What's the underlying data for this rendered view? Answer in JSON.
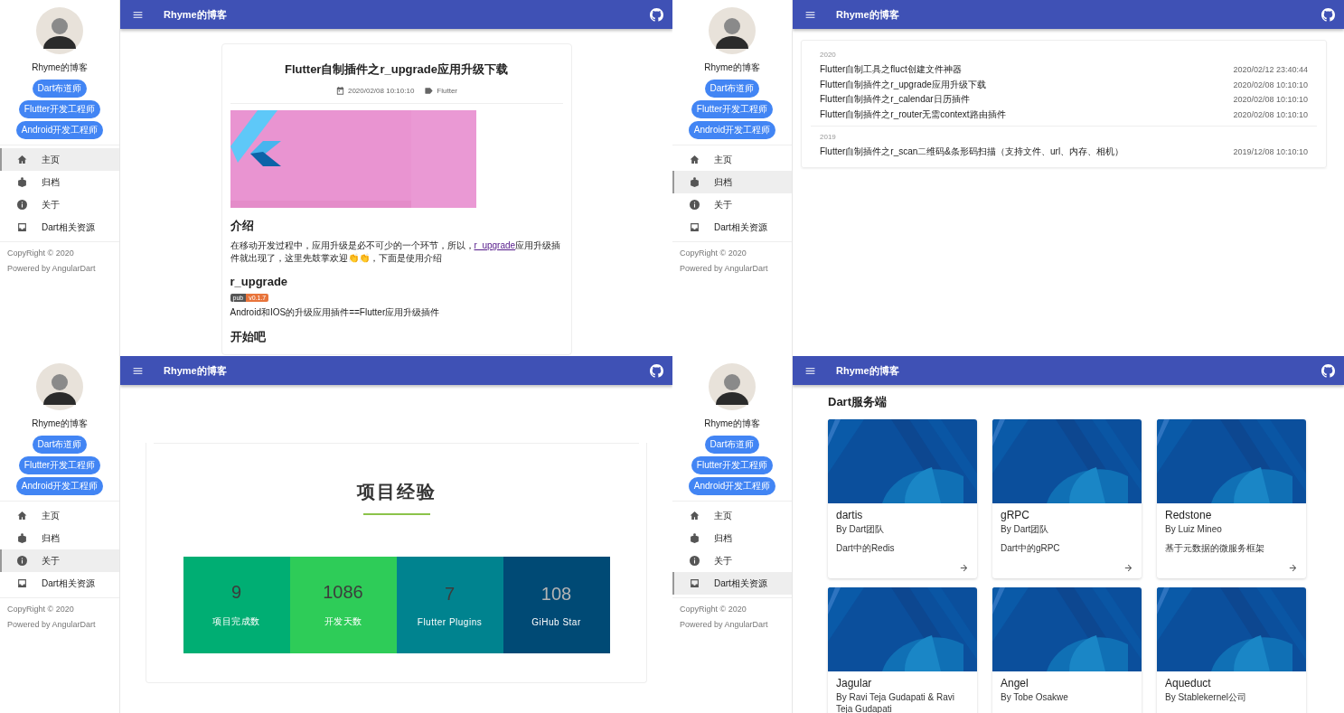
{
  "panels": [
    {
      "sidebar": {
        "blog_name": "Rhyme的博客",
        "tags": [
          "Dart布道师",
          "Flutter开发工程师",
          "Android开发工程师"
        ],
        "nav": [
          {
            "label": "主页",
            "selected": true
          },
          {
            "label": "归档",
            "selected": false
          },
          {
            "label": "关于",
            "selected": false
          },
          {
            "label": "Dart相关资源",
            "selected": false
          }
        ],
        "footer": [
          "CopyRight © 2020",
          "Powered by AngularDart"
        ]
      },
      "appbar": {
        "title": "Rhyme的博客"
      },
      "content": {
        "kind": "post",
        "title": "Flutter自制插件之r_upgrade应用升级下载",
        "date": "2020/02/08 10:10:10",
        "category": "Flutter",
        "blocks": [
          {
            "kind": "heading",
            "text": "介绍"
          },
          {
            "kind": "paragraph",
            "before": "在移动开发过程中，应用升级是必不可少的一个环节，所以，",
            "link": "r_upgrade",
            "after": "应用升级插件就出现了，这里先鼓掌欢迎👏👏，下面是使用介绍"
          },
          {
            "kind": "heading",
            "text": "r_upgrade"
          },
          {
            "kind": "badge",
            "label": "pub",
            "value": "v0.1.7"
          },
          {
            "kind": "paragraph",
            "before": "Android和IOS的升级应用插件==Flutter应用升级插件"
          },
          {
            "kind": "heading",
            "text": "开始吧"
          }
        ]
      }
    },
    {
      "sidebar": {
        "blog_name": "Rhyme的博客",
        "tags": [
          "Dart布道师",
          "Flutter开发工程师",
          "Android开发工程师"
        ],
        "nav": [
          {
            "label": "主页",
            "selected": false
          },
          {
            "label": "归档",
            "selected": true
          },
          {
            "label": "关于",
            "selected": false
          },
          {
            "label": "Dart相关资源",
            "selected": false
          }
        ],
        "footer": [
          "CopyRight © 2020",
          "Powered by AngularDart"
        ]
      },
      "appbar": {
        "title": "Rhyme的博客"
      },
      "content": {
        "kind": "archive",
        "groups": [
          {
            "year": "2020",
            "entries": [
              {
                "title": "Flutter自制工具之fluct创建文件神器",
                "date": "2020/02/12 23:40:44"
              },
              {
                "title": "Flutter自制插件之r_upgrade应用升级下载",
                "date": "2020/02/08 10:10:10"
              },
              {
                "title": "Flutter自制插件之r_calendar日历插件",
                "date": "2020/02/08 10:10:10"
              },
              {
                "title": "Flutter自制插件之r_router无需context路由插件",
                "date": "2020/02/08 10:10:10"
              }
            ]
          },
          {
            "year": "2019",
            "entries": [
              {
                "title": "Flutter自制插件之r_scan二维码&条形码扫描（支持文件、url、内存、相机）",
                "date": "2019/12/08 10:10:10"
              }
            ]
          }
        ]
      }
    },
    {
      "sidebar": {
        "blog_name": "Rhyme的博客",
        "tags": [
          "Dart布道师",
          "Flutter开发工程师",
          "Android开发工程师"
        ],
        "nav": [
          {
            "label": "主页",
            "selected": false
          },
          {
            "label": "归档",
            "selected": false
          },
          {
            "label": "关于",
            "selected": true
          },
          {
            "label": "Dart相关资源",
            "selected": false
          }
        ],
        "footer": [
          "CopyRight © 2020",
          "Powered by AngularDart"
        ]
      },
      "appbar": {
        "title": "Rhyme的博客"
      },
      "content": {
        "kind": "about",
        "heading": "项目经验",
        "stats": [
          {
            "value": "9",
            "label": "项目完成数",
            "color": "#00ae73"
          },
          {
            "value": "1086",
            "label": "开发天数",
            "color": "#2ecc58"
          },
          {
            "value": "7",
            "label": "Flutter Plugins",
            "color": "#00838f"
          },
          {
            "value": "108",
            "label": "GiHub Star",
            "color": "#004a75"
          }
        ]
      }
    },
    {
      "sidebar": {
        "blog_name": "Rhyme的博客",
        "tags": [
          "Dart布道师",
          "Flutter开发工程师",
          "Android开发工程师"
        ],
        "nav": [
          {
            "label": "主页",
            "selected": false
          },
          {
            "label": "归档",
            "selected": false
          },
          {
            "label": "关于",
            "selected": false
          },
          {
            "label": "Dart相关资源",
            "selected": true
          }
        ],
        "footer": [
          "CopyRight © 2020",
          "Powered by AngularDart"
        ]
      },
      "appbar": {
        "title": "Rhyme的博客"
      },
      "content": {
        "kind": "resources",
        "heading": "Dart服务端",
        "cards": [
          {
            "title": "dartis",
            "author": "By Dart团队",
            "description": "Dart中的Redis"
          },
          {
            "title": "gRPC",
            "author": "By Dart团队",
            "description": "Dart中的gRPC"
          },
          {
            "title": "Redstone",
            "author": "By Luiz Mineo",
            "description": "基于元数据的微服务框架"
          },
          {
            "title": "Jagular",
            "author": "By Ravi Teja Gudapati & Ravi Teja Gudapati"
          },
          {
            "title": "Angel",
            "author": "By Tobe Osakwe"
          },
          {
            "title": "Aqueduct",
            "author": "By Stablekernel公司"
          }
        ]
      }
    }
  ]
}
